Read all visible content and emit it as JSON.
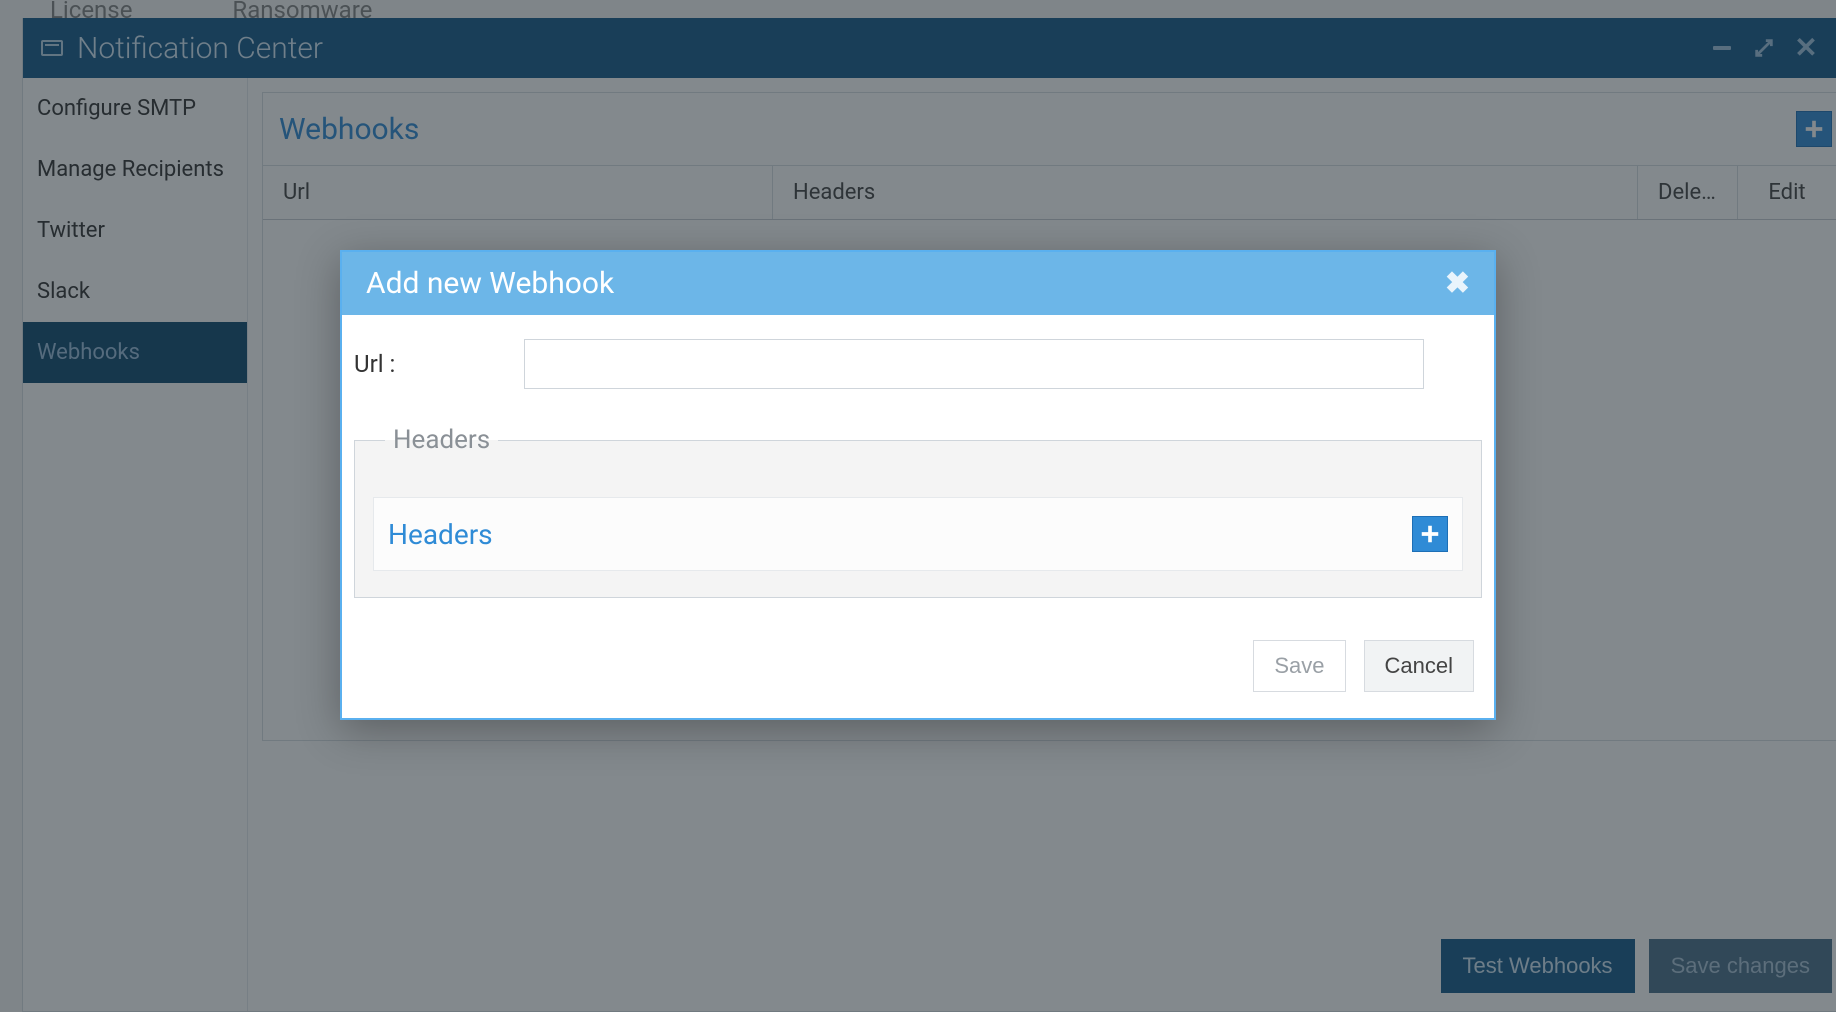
{
  "bg_tabs": {
    "license": "License",
    "ransomware": "Ransomware"
  },
  "window": {
    "title": "Notification Center"
  },
  "sidebar": {
    "items": [
      {
        "label": "Configure SMTP"
      },
      {
        "label": "Manage Recipients"
      },
      {
        "label": "Twitter"
      },
      {
        "label": "Slack"
      },
      {
        "label": "Webhooks"
      }
    ],
    "active_index": 4
  },
  "panel": {
    "title": "Webhooks",
    "columns": {
      "url": "Url",
      "headers": "Headers",
      "delete": "Dele…",
      "edit": "Edit"
    }
  },
  "footer": {
    "test": "Test Webhooks",
    "save": "Save changes"
  },
  "dialog": {
    "title": "Add new Webhook",
    "url_label": "Url :",
    "url_value": "",
    "headers_legend": "Headers",
    "headers_title": "Headers",
    "save": "Save",
    "cancel": "Cancel"
  }
}
